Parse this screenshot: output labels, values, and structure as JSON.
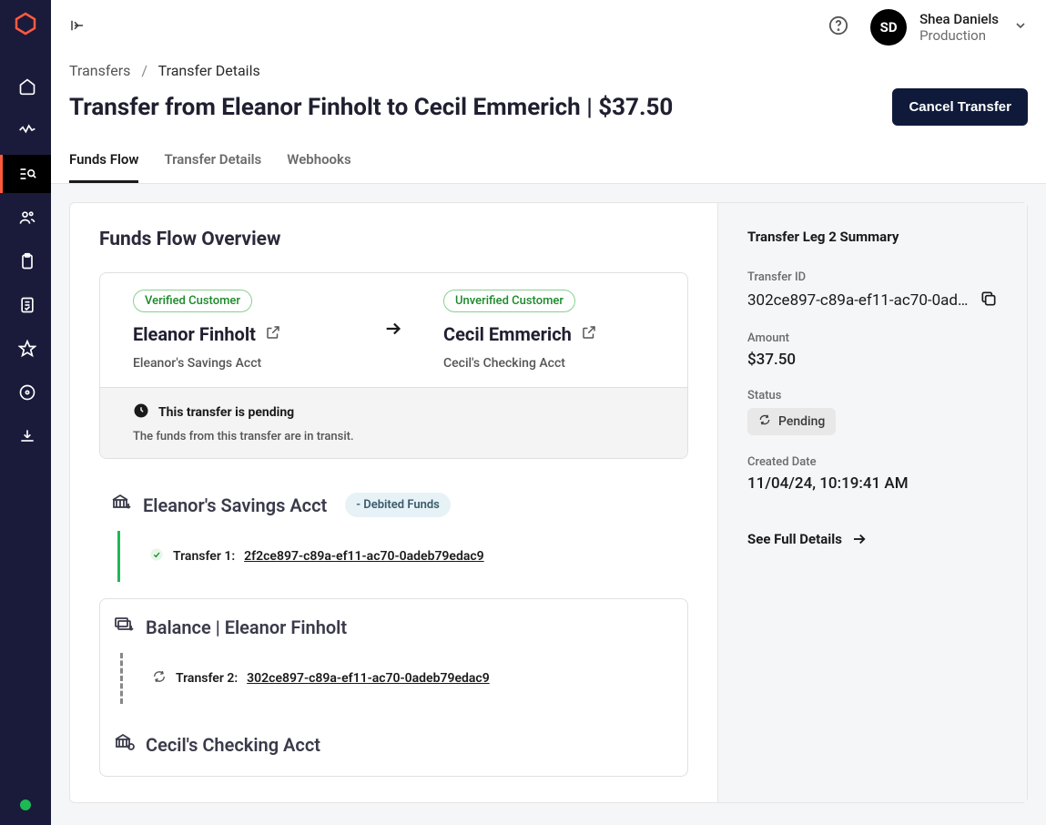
{
  "user": {
    "name": "Shea Daniels",
    "initials": "SD",
    "env": "Production"
  },
  "breadcrumb": {
    "parent": "Transfers",
    "current": "Transfer Details"
  },
  "page_title": "Transfer from Eleanor Finholt to Cecil Emmerich | $37.50",
  "cancel_button": "Cancel Transfer",
  "tabs": {
    "funds_flow": "Funds Flow",
    "transfer_details": "Transfer Details",
    "webhooks": "Webhooks"
  },
  "overview_title": "Funds Flow Overview",
  "from": {
    "badge": "Verified Customer",
    "name": "Eleanor Finholt",
    "account": "Eleanor's Savings Acct"
  },
  "to": {
    "badge": "Unverified Customer",
    "name": "Cecil Emmerich",
    "account": "Cecil's Checking Acct"
  },
  "pending": {
    "title": "This transfer is pending",
    "sub": "The funds from this transfer are in transit."
  },
  "flow": {
    "source_account": "Eleanor's Savings Acct",
    "debited_chip": "- Debited Funds",
    "transfer1_label": "Transfer 1: ",
    "transfer1_id": "2f2ce897-c89a-ef11-ac70-0adeb79edac9",
    "balance_label": "Balance | Eleanor Finholt",
    "transfer2_label": "Transfer 2: ",
    "transfer2_id": "302ce897-c89a-ef11-ac70-0adeb79edac9",
    "dest_account": "Cecil's Checking Acct"
  },
  "summary": {
    "title": "Transfer Leg 2 Summary",
    "id_label": "Transfer ID",
    "id_value": "302ce897-c89a-ef11-ac70-0ad…",
    "amount_label": "Amount",
    "amount_value": "$37.50",
    "status_label": "Status",
    "status_value": "Pending",
    "created_label": "Created Date",
    "created_value": "11/04/24, 10:19:41 AM",
    "see_details": "See Full Details"
  }
}
